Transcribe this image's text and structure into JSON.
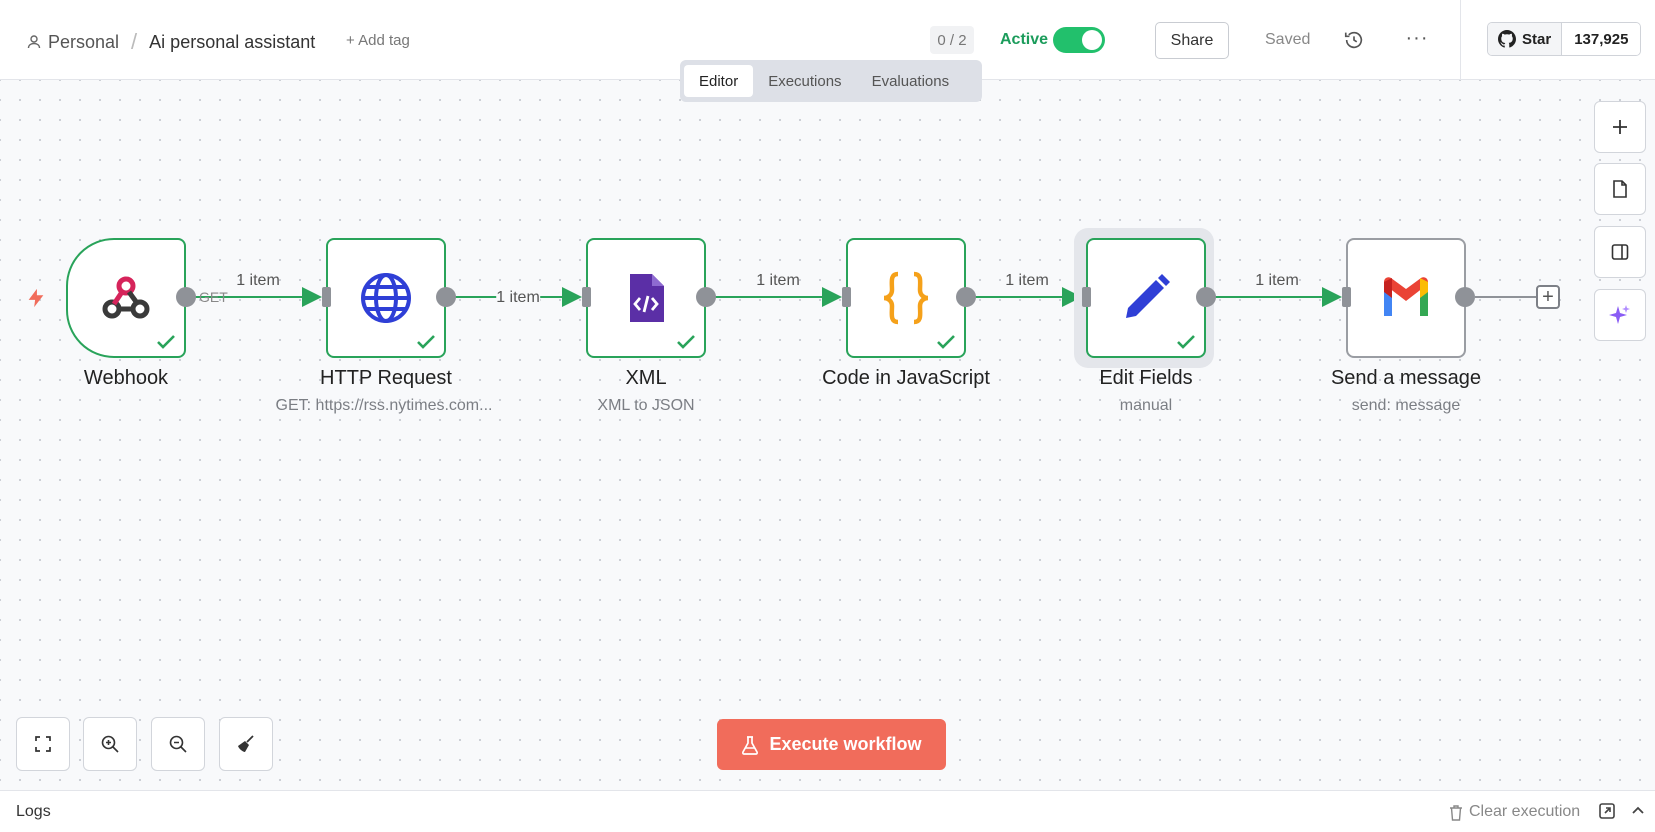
{
  "header": {
    "project": "Personal",
    "workflow_name": "Ai personal assistant",
    "add_tag": "+ Add tag",
    "counter": "0 / 2",
    "active_label": "Active",
    "share": "Share",
    "saved": "Saved",
    "more": "···",
    "github_star": "Star",
    "github_count": "137,925"
  },
  "tabs": [
    {
      "label": "Editor",
      "active": true
    },
    {
      "label": "Executions",
      "active": false
    },
    {
      "label": "Evaluations",
      "active": false
    }
  ],
  "nodes": [
    {
      "title": "Webhook",
      "subtitle": "",
      "icon": "webhook-icon",
      "status": "success"
    },
    {
      "title": "HTTP Request",
      "subtitle": "GET: https://rss.nytimes.com...",
      "icon": "globe-icon",
      "status": "success"
    },
    {
      "title": "XML",
      "subtitle": "XML to JSON",
      "icon": "xml-file-icon",
      "status": "success"
    },
    {
      "title": "Code in JavaScript",
      "subtitle": "",
      "icon": "code-braces-icon",
      "status": "success"
    },
    {
      "title": "Edit Fields",
      "subtitle": "manual",
      "icon": "pencil-icon",
      "status": "success",
      "selected": true
    },
    {
      "title": "Send a message",
      "subtitle": "send: message",
      "icon": "gmail-icon",
      "status": "none"
    }
  ],
  "edges": {
    "webhook_method": "GET",
    "labels": [
      "1 item",
      "1 item",
      "1 item",
      "1 item",
      "1 item"
    ]
  },
  "execute_button": "Execute workflow",
  "logs": {
    "label": "Logs",
    "clear": "Clear execution"
  },
  "colors": {
    "success": "#29a35a",
    "active_toggle": "#22c06c",
    "execute": "#f16c5b",
    "node_gray": "#9a9da3"
  }
}
